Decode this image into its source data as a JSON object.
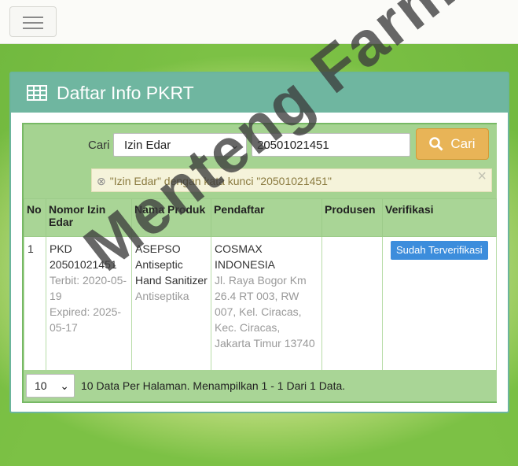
{
  "panel": {
    "title": "Daftar Info PKRT"
  },
  "search": {
    "label": "Cari",
    "field_selected": "Izin Edar",
    "keyword_value": "20501021451",
    "button_label": "Cari"
  },
  "alert": {
    "message": "\"Izin Edar\" dengan kata kunci \"20501021451\""
  },
  "table": {
    "headers": [
      "No",
      "Nomor Izin Edar",
      "Nama Produk",
      "Pendaftar",
      "Produsen",
      "Verifikasi"
    ],
    "rows": [
      {
        "no": "1",
        "izin": "PKD 20501021451",
        "terbit": "Terbit: 2020-05-19",
        "expired": "Expired: 2025-05-17",
        "produk": "ASEPSO Antiseptic Hand Sanitizer",
        "kategori": "Antiseptika",
        "pendaftar": "COSMAX INDONESIA",
        "alamat": "Jl. Raya Bogor Km 26.4 RT 003, RW 007, Kel. Ciracas, Kec. Ciracas, Jakarta Timur 13740",
        "produsen": "",
        "verifikasi": "Sudah Terverifikasi"
      }
    ]
  },
  "pagination": {
    "per_page": "10",
    "summary": "10 Data Per Halaman. Menampilkan 1 - 1 Dari 1 Data."
  },
  "watermark": "Menteng Farma",
  "colors": {
    "header": "#6fb6a0",
    "accent": "#e8b457",
    "badge": "#3c8ddc"
  }
}
